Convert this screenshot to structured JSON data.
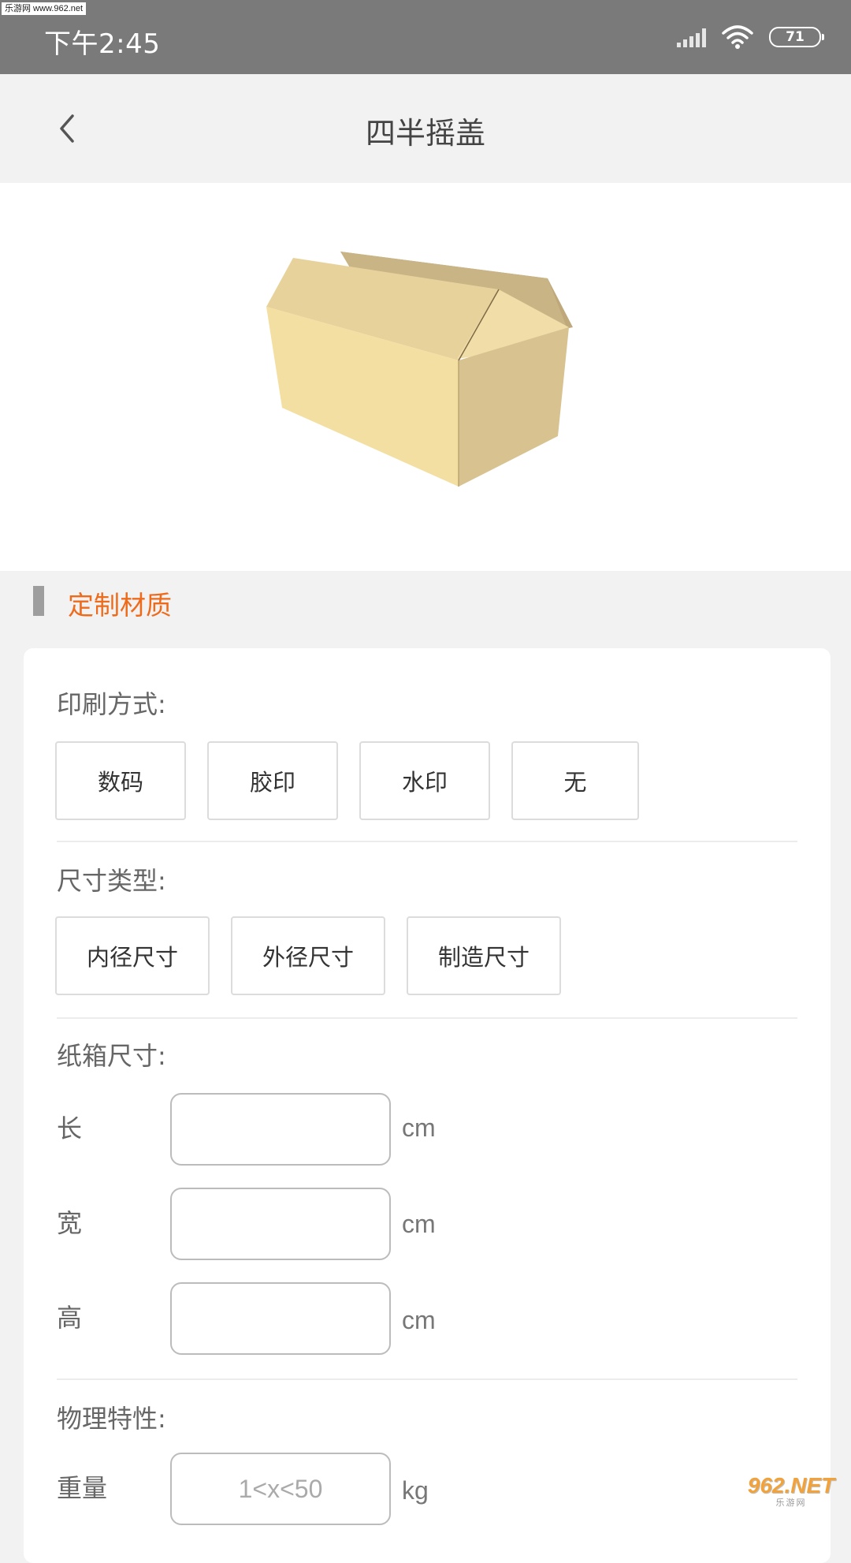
{
  "status_bar": {
    "watermark": "乐游网 www.962.net",
    "time": "下午2:45",
    "battery": "71",
    "icons": [
      "signal-icon",
      "wifi-icon",
      "battery-icon"
    ]
  },
  "nav": {
    "title": "四半摇盖",
    "back_icon": "back-arrow-icon"
  },
  "hero": {
    "image": "cardboard-box-illustration"
  },
  "section": {
    "title": "定制材质",
    "accent": "#ee6b1c"
  },
  "print_method": {
    "label": "印刷方式:",
    "options": [
      "数码",
      "胶印",
      "水印",
      "无"
    ]
  },
  "size_type": {
    "label": "尺寸类型:",
    "options": [
      "内径尺寸",
      "外径尺寸",
      "制造尺寸"
    ]
  },
  "box_size": {
    "label": "纸箱尺寸:",
    "fields": [
      {
        "label": "长",
        "unit": "cm",
        "value": ""
      },
      {
        "label": "宽",
        "unit": "cm",
        "value": ""
      },
      {
        "label": "高",
        "unit": "cm",
        "value": ""
      }
    ]
  },
  "physical": {
    "label": "物理特性:",
    "weight": {
      "label": "重量",
      "placeholder": "1<x<50",
      "unit": "kg"
    }
  },
  "logo": {
    "big": "962.NET",
    "small": "乐游网"
  }
}
